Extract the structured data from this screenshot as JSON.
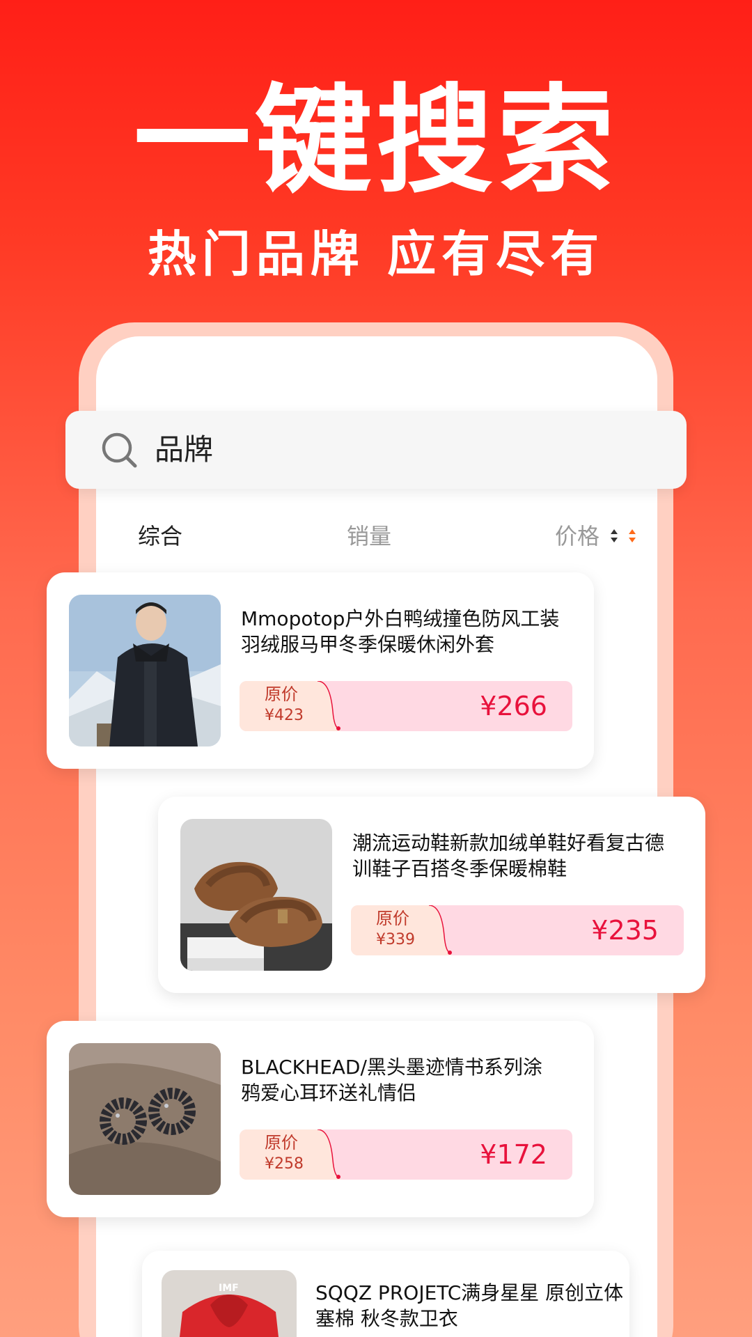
{
  "hero": {
    "headline": "一键搜索",
    "subline": "热门品牌 应有尽有"
  },
  "search": {
    "query": "品牌"
  },
  "sort_tabs": {
    "overall": "综合",
    "sales": "销量",
    "price": "价格"
  },
  "products": [
    {
      "title_line1": "Mmopotop户外白鸭绒撞色防风工装",
      "title_line2": "羽绒服马甲冬季保暖休闲外套",
      "orig_label": "原价",
      "orig_price": "¥423",
      "sale_price": "¥266"
    },
    {
      "title_line1": "潮流运动鞋新款加绒单鞋好看复古德",
      "title_line2": "训鞋子百搭冬季保暖棉鞋",
      "orig_label": "原价",
      "orig_price": "¥339",
      "sale_price": "¥235"
    },
    {
      "title_line1": "BLACKHEAD/黑头墨迹情书系列涂",
      "title_line2": "鸦爱心耳环送礼情侣",
      "orig_label": "原价",
      "orig_price": "¥258",
      "sale_price": "¥172"
    },
    {
      "title_line1": "SQQZ PROJETC满身星星 原创立体",
      "title_line2": "塞棉 秋冬款卫衣"
    }
  ],
  "colors": {
    "bg_top": "#ff1f17",
    "bg_bottom": "#ff9f7e",
    "sale_price": "#e8123c",
    "price_box": "#ffd9e3",
    "orig_seg": "#ffe6dc",
    "sort_arrow_active": "#ff6a1a"
  }
}
